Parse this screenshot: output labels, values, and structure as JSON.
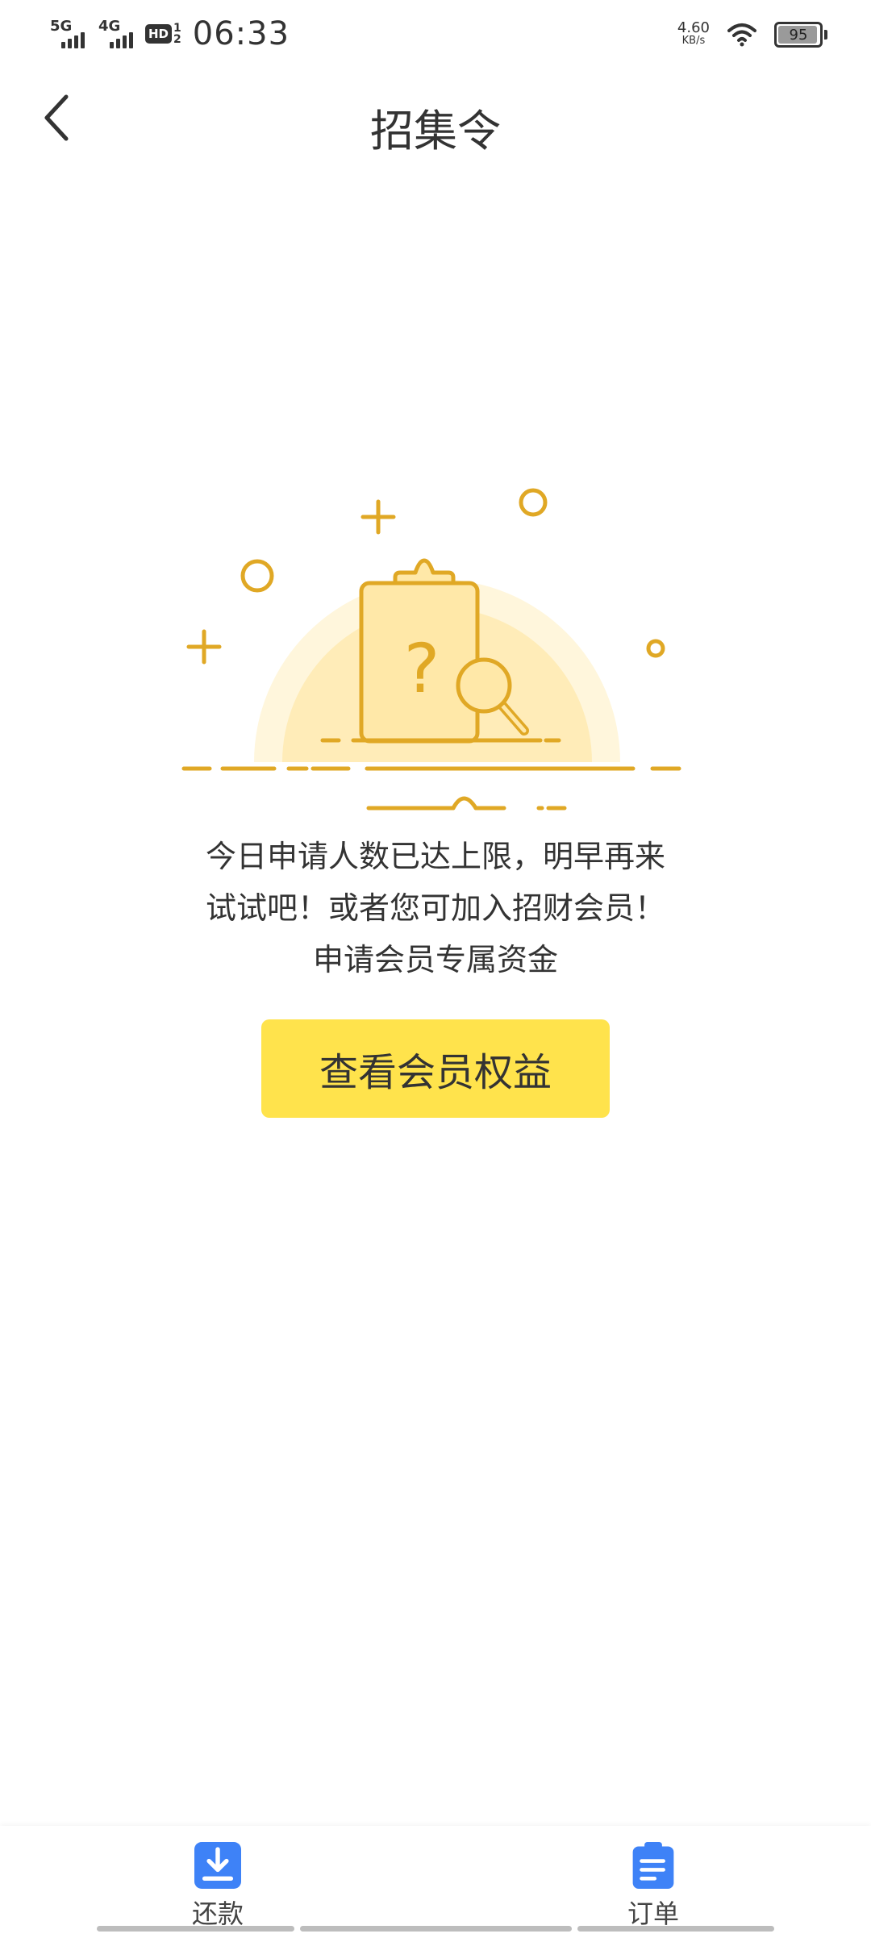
{
  "status_bar": {
    "network_1": "5G",
    "network_2": "4G",
    "hd_label": "HD",
    "hd_sub_top": "1",
    "hd_sub_bottom": "2",
    "time": "06:33",
    "speed_value": "4.60",
    "speed_unit": "KB/s",
    "battery_level": "95",
    "battery_fraction": 0.95
  },
  "nav": {
    "title": "招集令"
  },
  "empty_state": {
    "illustration_icon": "clipboard-search-illustration",
    "message_line_1": "今日申请人数已达上限，明早再来",
    "message_line_2": "试试吧！或者您可加入招财会员！",
    "message_line_3": "申请会员专属资金",
    "button_label": "查看会员权益"
  },
  "tab_bar": {
    "tabs": [
      {
        "label": "还款",
        "icon": "download-icon"
      },
      {
        "label": "订单",
        "icon": "document-list-icon"
      }
    ]
  },
  "colors": {
    "accent_button": "#ffe34c",
    "illustration_stroke": "#e0a825",
    "illustration_fill": "#ffe8a8",
    "tab_icon": "#3e82f7",
    "text": "#333333"
  }
}
